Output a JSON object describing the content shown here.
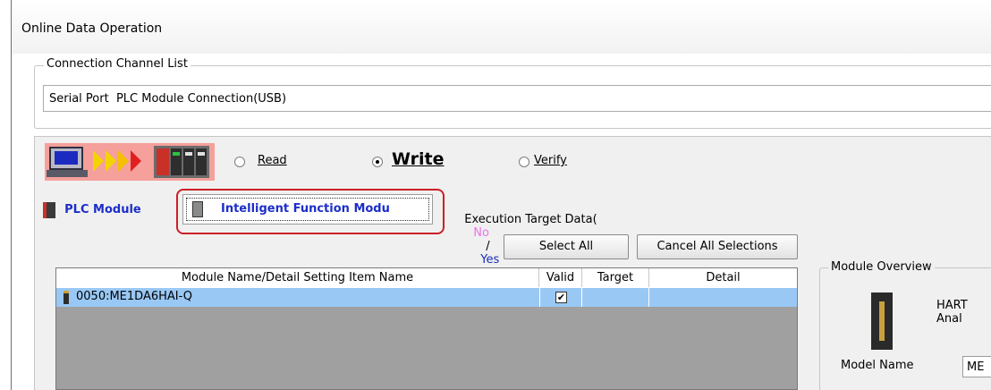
{
  "window": {
    "title": "Online Data Operation"
  },
  "connection": {
    "group_label": "Connection Channel List",
    "channel_value": "Serial Port  PLC Module Connection(USB)"
  },
  "operation": {
    "read_label": "Read",
    "write_label": "Write",
    "verify_label": "Verify",
    "selected": "Write"
  },
  "tabs": {
    "plc_module": "PLC Module",
    "intelligent": "Intelligent Function Modu"
  },
  "exec_target": {
    "prefix": "Execution Target Data(",
    "no": "No",
    "slash": "/",
    "yes": "Yes",
    "suffix": ")"
  },
  "buttons": {
    "select_all": "Select All",
    "cancel_all": "Cancel All Selections"
  },
  "table": {
    "headers": [
      "Module Name/Detail Setting Item Name",
      "Valid",
      "Target",
      "Detail"
    ],
    "rows": [
      {
        "name": "0050:ME1DA6HAI-Q",
        "valid": true,
        "target": "",
        "detail": ""
      }
    ]
  },
  "overview": {
    "group_label": "Module Overview",
    "module_desc": "HART Anal",
    "model_name_label": "Model Name",
    "model_name_value": "ME"
  },
  "colors": {
    "selection_row": "#99c8f5",
    "tab_text": "#1c2ec8",
    "no_color": "#e874e8",
    "yes_color": "#1a2cb8",
    "highlight": "#cc1f26"
  }
}
